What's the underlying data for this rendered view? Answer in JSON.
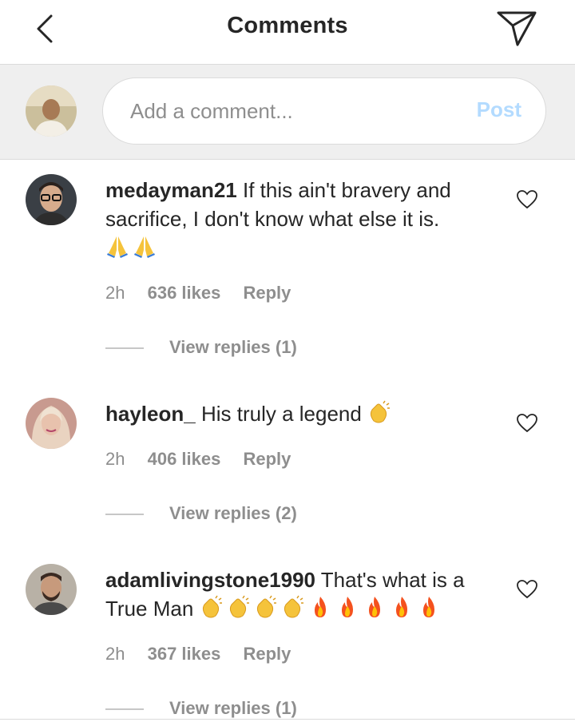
{
  "header": {
    "title": "Comments",
    "back_icon": "chevron-left-icon",
    "send_icon": "paper-plane-icon"
  },
  "composer": {
    "placeholder": "Add a comment...",
    "value": "",
    "post_label": "Post",
    "post_color": "#b3dbff"
  },
  "comments": [
    {
      "username": "medayman21",
      "text": "If this ain't bravery and sacrifice, I don't know what else it is.",
      "emojis": [
        "folded-hands",
        "folded-hands"
      ],
      "time": "2h",
      "likes": "636 likes",
      "reply": "Reply",
      "view_replies": "View replies (1)"
    },
    {
      "username": "hayleon_",
      "text": "His truly a legend",
      "emojis": [
        "clapping-hands"
      ],
      "time": "2h",
      "likes": "406 likes",
      "reply": "Reply",
      "view_replies": "View replies (2)"
    },
    {
      "username": "adamlivingstone1990",
      "text": "That's what is a True Man",
      "emojis": [
        "clapping-hands",
        "clapping-hands",
        "clapping-hands",
        "clapping-hands",
        "fire",
        "fire",
        "fire",
        "fire",
        "fire"
      ],
      "time": "2h",
      "likes": "367 likes",
      "reply": "Reply",
      "view_replies": "View replies (1)"
    }
  ],
  "colors": {
    "text": "#262626",
    "secondary": "#8e8e8e",
    "divider": "#dbdbdb",
    "composer_bg": "#efefef"
  }
}
